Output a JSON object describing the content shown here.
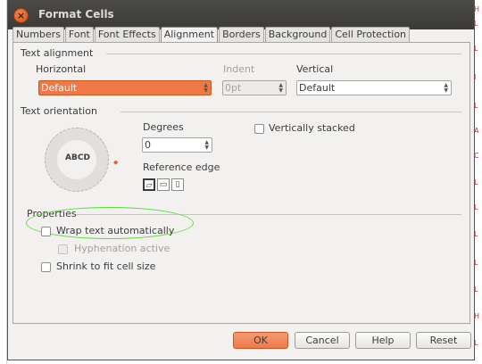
{
  "window": {
    "title": "Format Cells",
    "close_glyph": "×"
  },
  "tabs": [
    {
      "label": "Numbers"
    },
    {
      "label": "Font"
    },
    {
      "label": "Font Effects"
    },
    {
      "label": "Alignment"
    },
    {
      "label": "Borders"
    },
    {
      "label": "Background"
    },
    {
      "label": "Cell Protection"
    }
  ],
  "active_tab": "Alignment",
  "text_alignment": {
    "heading": "Text alignment",
    "horizontal_label": "Horizontal",
    "horizontal_value": "Default",
    "indent_label": "Indent",
    "indent_value": "0pt",
    "vertical_label": "Vertical",
    "vertical_value": "Default"
  },
  "text_orientation": {
    "heading": "Text orientation",
    "dial_text": "ABCD",
    "degrees_label": "Degrees",
    "degrees_value": "0",
    "reference_edge_label": "Reference edge",
    "vertically_stacked_label": "Vertically stacked"
  },
  "properties": {
    "heading": "Properties",
    "wrap_text_label": "Wrap text automatically",
    "hyphenation_label": "Hyphenation active",
    "shrink_label": "Shrink to fit cell size"
  },
  "buttons": {
    "ok": "OK",
    "cancel": "Cancel",
    "help": "Help",
    "reset": "Reset"
  },
  "colors": {
    "accent": "#f07746",
    "highlight_ring": "#5adb3a",
    "titlebar": "#3b3a36"
  }
}
